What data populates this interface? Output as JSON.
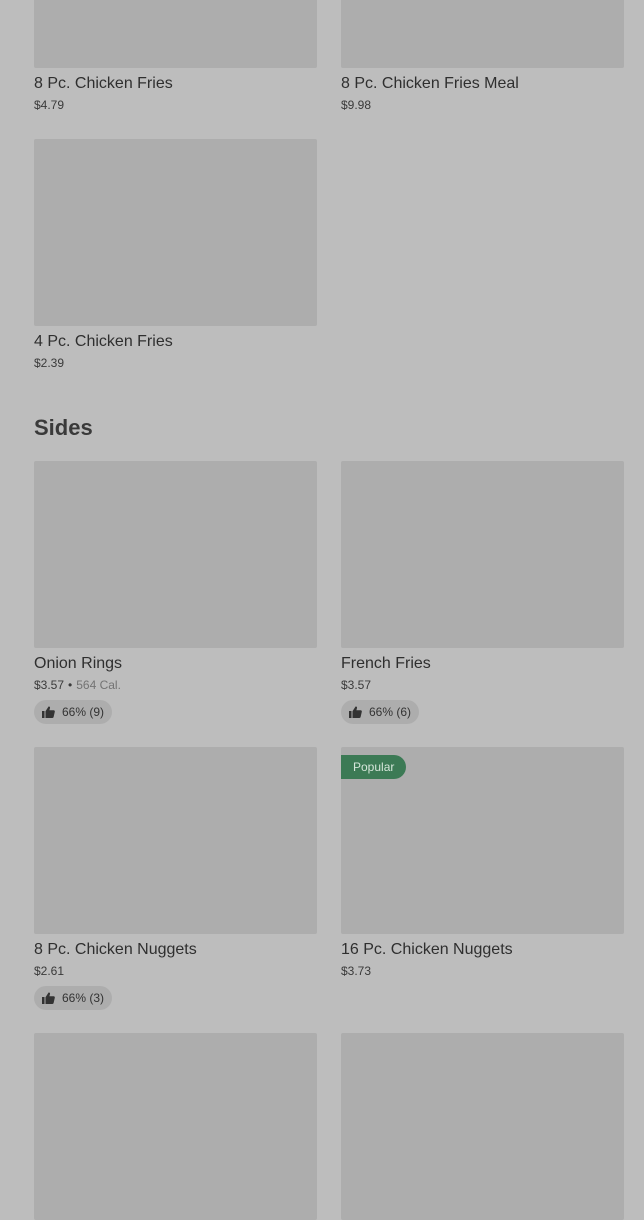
{
  "top_items": [
    {
      "name": "8 Pc. Chicken Fries",
      "price": "$4.79"
    },
    {
      "name": "8 Pc. Chicken Fries Meal",
      "price": "$9.98"
    },
    {
      "name": "4 Pc. Chicken Fries",
      "price": "$2.39"
    }
  ],
  "sides": {
    "title": "Sides",
    "items": [
      {
        "name": "Onion Rings",
        "price": "$3.57",
        "separator": "•",
        "calories": "564 Cal.",
        "rating": "66% (9)"
      },
      {
        "name": "French Fries",
        "price": "$3.57",
        "rating": "66% (6)"
      },
      {
        "name": "8 Pc. Chicken Nuggets",
        "price": "$2.61",
        "rating": "66% (3)"
      },
      {
        "name": "16 Pc. Chicken Nuggets",
        "price": "$3.73",
        "badge": "Popular"
      }
    ]
  },
  "icons": {
    "rating": "thumbs-up-icon"
  },
  "colors": {
    "background": "#bdbdbd",
    "image_placeholder": "#adadad",
    "popular_badge": "#3c7a55"
  }
}
